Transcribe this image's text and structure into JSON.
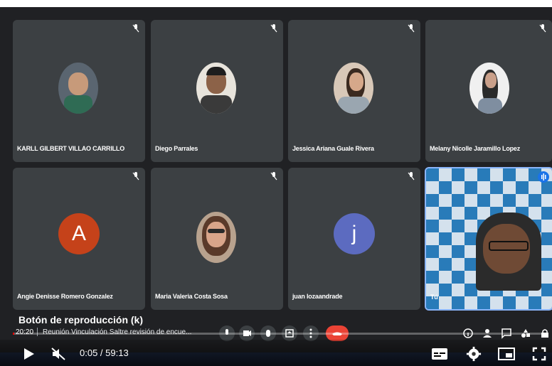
{
  "participants": [
    {
      "name": "KARLL GILBERT VILLAO CARRILLO",
      "type": "photo"
    },
    {
      "name": "Diego Parrales",
      "type": "photo"
    },
    {
      "name": "Jessica Ariana Guale Rivera",
      "type": "photo"
    },
    {
      "name": "Melany Nicolle Jaramillo Lopez",
      "type": "photo"
    },
    {
      "name": "Angie Denisse Romero Gonzalez",
      "type": "letter",
      "letter": "A",
      "color": "#c5421a"
    },
    {
      "name": "Maria Valeria Costa Sosa",
      "type": "photo"
    },
    {
      "name": "juan lozaandrade",
      "type": "letter",
      "letter": "j",
      "color": "#5c6bc0"
    },
    {
      "name": "Tú",
      "type": "self"
    }
  ],
  "overlay": {
    "title": "Botón de reproducción (k)"
  },
  "meet_bar": {
    "clock": "20:20",
    "meeting_title": "Reunión Vinculación Saltre revisión de encue..."
  },
  "player": {
    "current_time": "0:05",
    "duration": "59:13",
    "time_display": "0:05 / 59:13",
    "progress_fraction": 0.0014
  },
  "colors": {
    "background": "#202124",
    "tile": "#3c4043",
    "accent": "#8ab4f8",
    "hangup": "#ea4335",
    "progress": "#ff0000"
  },
  "icons": [
    "mic-off-icon",
    "play-icon",
    "mute-icon",
    "subtitles-icon",
    "settings-icon",
    "miniplayer-icon",
    "fullscreen-icon",
    "hangup-icon"
  ]
}
